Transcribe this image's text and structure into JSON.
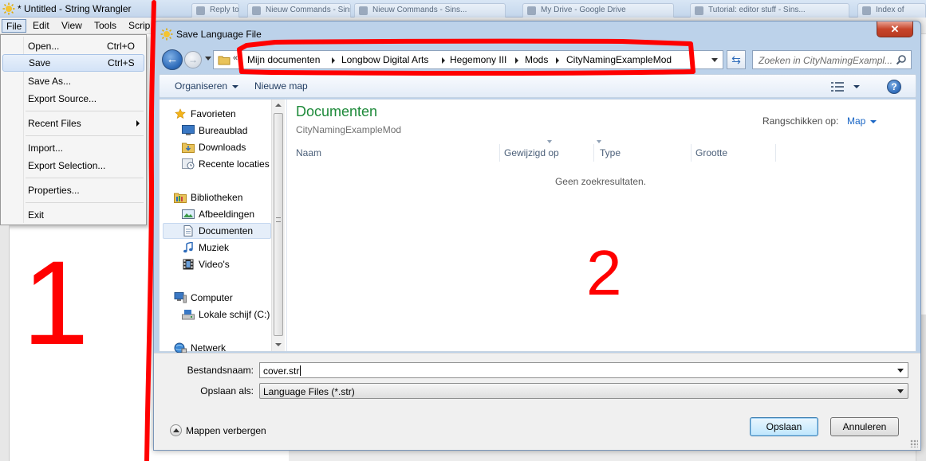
{
  "app": {
    "title": "* Untitled - String Wrangler",
    "menus": [
      "File",
      "Edit",
      "View",
      "Tools",
      "Scrip"
    ],
    "taskbar_tabs": [
      "Reply to Topic",
      "Nieuw Commands - Sins...",
      "Nieuw Commands - Sins...",
      "My Drive - Google Drive",
      "Tutorial: editor stuff - Sins...",
      "Index of"
    ]
  },
  "file_menu": {
    "items": [
      {
        "label": "Open...",
        "shortcut": "Ctrl+O"
      },
      {
        "label": "Save",
        "shortcut": "Ctrl+S"
      },
      {
        "label": "Save As...",
        "shortcut": ""
      },
      {
        "label": "Export Source...",
        "shortcut": ""
      },
      {
        "label": "Recent Files",
        "shortcut": ""
      },
      {
        "label": "Import...",
        "shortcut": ""
      },
      {
        "label": "Export Selection...",
        "shortcut": ""
      },
      {
        "label": "Properties...",
        "shortcut": ""
      },
      {
        "label": "Exit",
        "shortcut": ""
      }
    ]
  },
  "dialog": {
    "title": "Save Language File",
    "close_glyph": "✕",
    "breadcrumb": [
      "Mijn documenten",
      "Longbow Digital Arts",
      "Hegemony III",
      "Mods",
      "CityNamingExampleMod"
    ],
    "search_placeholder": "Zoeken in CityNamingExampl...",
    "toolbar": {
      "organize": "Organiseren",
      "new_folder": "Nieuwe map"
    },
    "nav": {
      "favorites": "Favorieten",
      "fav_items": [
        "Bureaublad",
        "Downloads",
        "Recente locaties"
      ],
      "libraries": "Bibliotheken",
      "lib_items": [
        "Afbeeldingen",
        "Documenten",
        "Muziek",
        "Video's"
      ],
      "computer": "Computer",
      "comp_items": [
        "Lokale schijf (C:)"
      ],
      "network": "Netwerk"
    },
    "main": {
      "library_title": "Documenten",
      "library_subtitle": "CityNamingExampleMod",
      "arrange_label": "Rangschikken op:",
      "arrange_value": "Map",
      "columns": [
        "Naam",
        "Gewijzigd op",
        "Type",
        "Grootte"
      ],
      "empty_message": "Geen zoekresultaten."
    },
    "form": {
      "filename_label": "Bestandsnaam:",
      "filename_value": "cover.str",
      "savetype_label": "Opslaan als:",
      "savetype_value": "Language Files (*.str)",
      "hide_folders": "Mappen verbergen",
      "save_button": "Opslaan",
      "cancel_button": "Annuleren"
    }
  },
  "annotations": {
    "label_1": "1",
    "label_2": "2",
    "color": "#ff0000"
  }
}
